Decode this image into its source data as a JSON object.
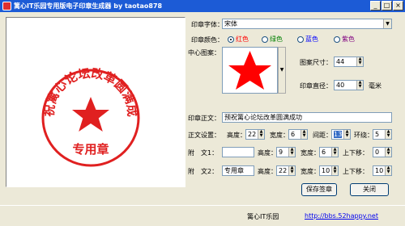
{
  "window": {
    "title": "篱心IT乐园专用版电子印章生成器 by taotao878",
    "minimize": "_",
    "maximize": "□",
    "close": "×"
  },
  "preview": {
    "ring_text": "预祝篱心论坛改革圆满成功",
    "bottom_text": "专用章",
    "accent": "#e02020"
  },
  "font": {
    "label": "印章字体：",
    "value": "宋体"
  },
  "color": {
    "label": "印章颜色：",
    "options": [
      {
        "label": "红色",
        "color": "#ff0000",
        "selected": true
      },
      {
        "label": "绿色",
        "color": "#008000",
        "selected": false
      },
      {
        "label": "蓝色",
        "color": "#0000ff",
        "selected": false
      },
      {
        "label": "紫色",
        "color": "#800080",
        "selected": false
      }
    ]
  },
  "pattern": {
    "label": "中心图案：",
    "icon": "star-icon"
  },
  "size": {
    "label": "图案尺寸：",
    "value": "44"
  },
  "diameter": {
    "label": "印章直径：",
    "value": "40",
    "unit": "毫米"
  },
  "main_text": {
    "label": "印章正文：",
    "value": "预祝篱心论坛改革圆满成功"
  },
  "main_settings": {
    "label": "正文设置：",
    "height_label": "高度：",
    "height": "22",
    "width_label": "宽度：",
    "width": "6",
    "spacing_label": "间距：",
    "spacing": "13",
    "ring_label": "环绕：",
    "ring": "5"
  },
  "attach1": {
    "label": "附　文1：",
    "value": "",
    "height_label": "高度：",
    "height": "9",
    "width_label": "宽度：",
    "width": "6",
    "offset_label": "上下移：",
    "offset": "0"
  },
  "attach2": {
    "label": "附　文2：",
    "value": "专用章",
    "height_label": "高度：",
    "height": "22",
    "width_label": "宽度：",
    "width": "10",
    "offset_label": "上下移：",
    "offset": "10"
  },
  "buttons": {
    "save": "保存签章",
    "close": "关闭"
  },
  "status": {
    "name": "篱心IT乐园",
    "url": "http://bbs.52happy.net"
  }
}
